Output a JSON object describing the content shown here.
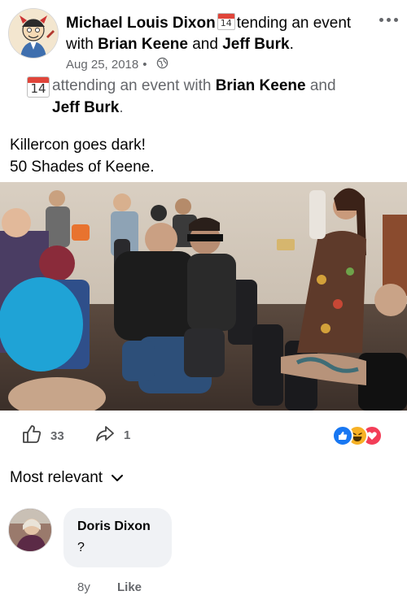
{
  "post": {
    "author": "Michael Louis Dixon",
    "header_action_1": "tending an event",
    "header_with": "with",
    "header_person_1": "Brian Keene",
    "header_and": "and",
    "header_person_2": "Jeff Burk",
    "header_period": ".",
    "calendar_day": "14",
    "date": "Aug 25, 2018",
    "separator": "•",
    "event_line_1": "attending an event with",
    "event_line_person_1": "Brian Keene",
    "event_line_and": "and",
    "event_line_person_2": "Jeff Burk",
    "event_line_period": ".",
    "caption_line_1": "Killercon goes dark!",
    "caption_line_2": "50 Shades of Keene."
  },
  "reactions": {
    "likes": "33",
    "shares": "1",
    "icons": [
      "like-reaction-icon",
      "haha-reaction-icon",
      "love-reaction-icon"
    ],
    "colors": {
      "like": "#1877f2",
      "haha": "#f7b125",
      "love": "#f33e58"
    }
  },
  "comments": {
    "sort_label": "Most relevant",
    "items": [
      {
        "author": "Doris Dixon",
        "text": "?",
        "time": "8y",
        "like_label": "Like"
      }
    ]
  }
}
